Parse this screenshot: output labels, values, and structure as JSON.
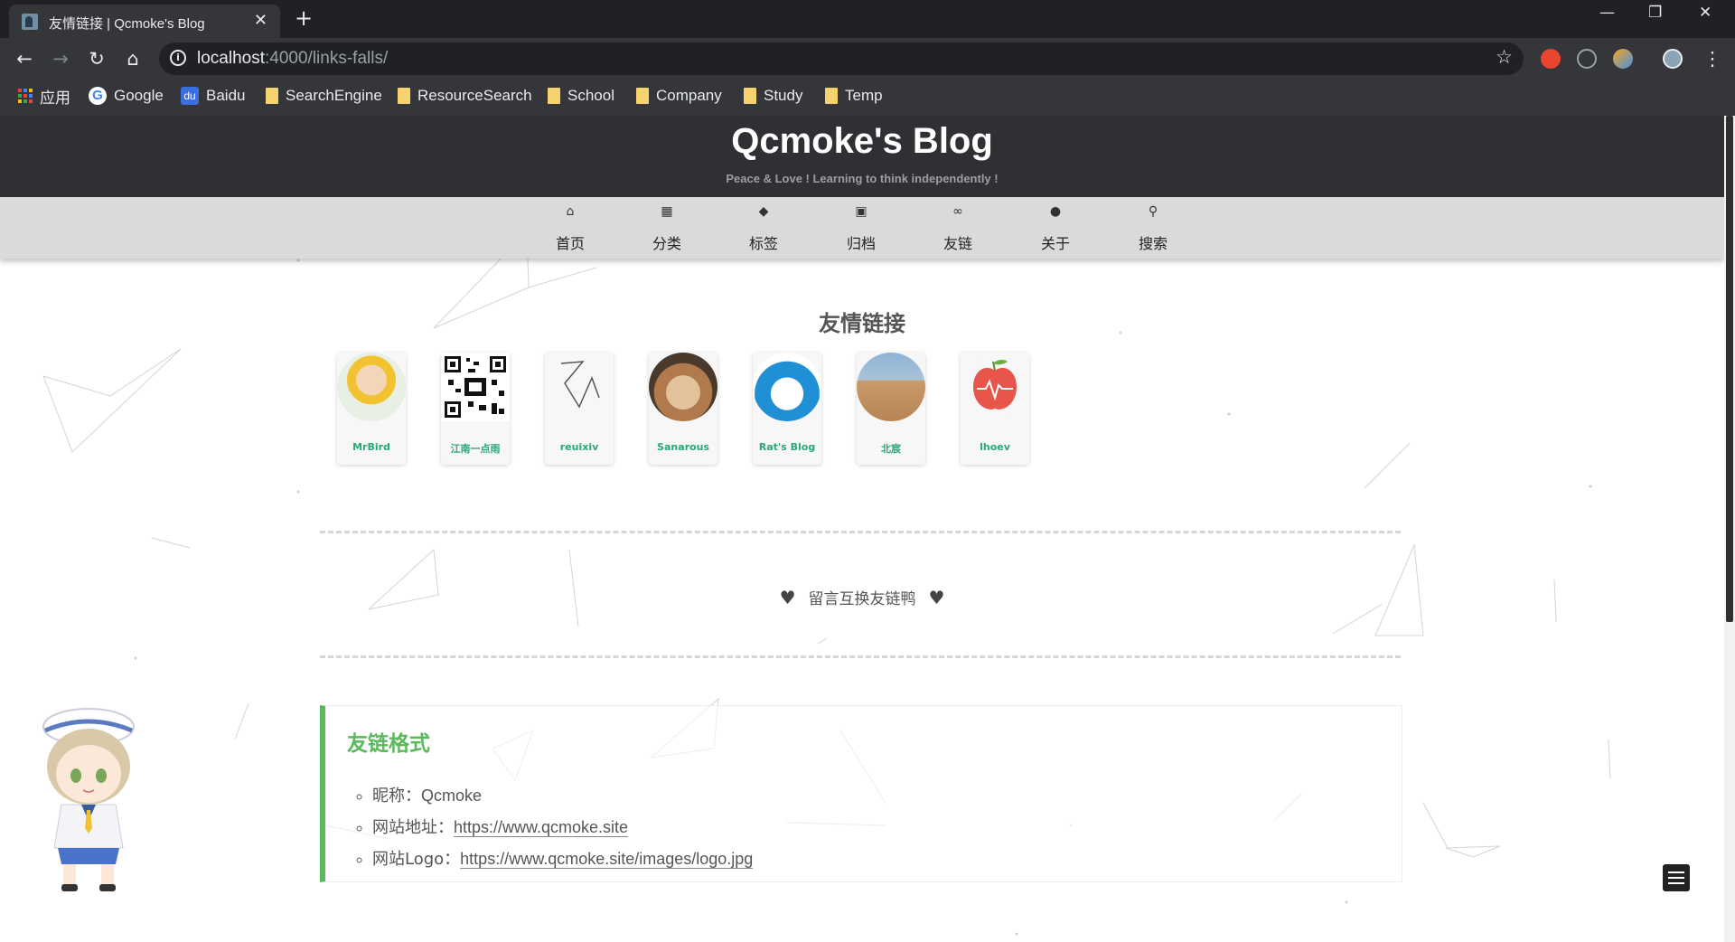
{
  "browser": {
    "tab_title": "友情链接 | Qcmoke's Blog",
    "tab_close": "✕",
    "new_tab": "+",
    "url_host": "localhost",
    "url_path": ":4000/links-falls/",
    "bookmarks": [
      "应用",
      "Google",
      "Baidu",
      "SearchEngine",
      "ResourceSearch",
      "School",
      "Company",
      "Study",
      "Temp"
    ]
  },
  "header": {
    "title": "Qcmoke's Blog",
    "subtitle": "Peace & Love ! Learning to think independently !"
  },
  "nav": [
    {
      "label": "首页",
      "icon": "home-icon",
      "glyph": "⌂"
    },
    {
      "label": "分类",
      "icon": "grid-icon",
      "glyph": "▦"
    },
    {
      "label": "标签",
      "icon": "tags-icon",
      "glyph": "◆"
    },
    {
      "label": "归档",
      "icon": "archive-icon",
      "glyph": "▣"
    },
    {
      "label": "友链",
      "icon": "link-icon",
      "glyph": "∞"
    },
    {
      "label": "关于",
      "icon": "user-icon",
      "glyph": "●"
    },
    {
      "label": "搜索",
      "icon": "search-icon",
      "glyph": "⚲"
    }
  ],
  "main": {
    "title": "友情链接",
    "friends": [
      {
        "name": "MrBird",
        "avatar": "anime-avatar"
      },
      {
        "name": "江南一点雨",
        "avatar": "qr-code-avatar"
      },
      {
        "name": "reuixiv",
        "avatar": "sketch-logo-avatar"
      },
      {
        "name": "Sanarous",
        "avatar": "dog-avatar"
      },
      {
        "name": "Rat's Blog",
        "avatar": "doraemon-avatar"
      },
      {
        "name": "北宸",
        "avatar": "desert-avatar"
      },
      {
        "name": "lhoev",
        "avatar": "apple-avatar"
      }
    ],
    "comment_text": "留言互换友链鸭",
    "format": {
      "title": "友链格式",
      "items": [
        {
          "label": "昵称：",
          "value": "Qcmoke",
          "link": false
        },
        {
          "label": "网站地址：",
          "value": "https://www.qcmoke.site",
          "link": true
        },
        {
          "label": "网站Logo：",
          "value": "https://www.qcmoke.site/images/logo.jpg",
          "link": true
        }
      ]
    }
  },
  "colors": {
    "header_bg": "#2f3033",
    "nav_bg": "#dadada",
    "accent_green": "#5cb85c",
    "friend_name": "#2aa876"
  }
}
